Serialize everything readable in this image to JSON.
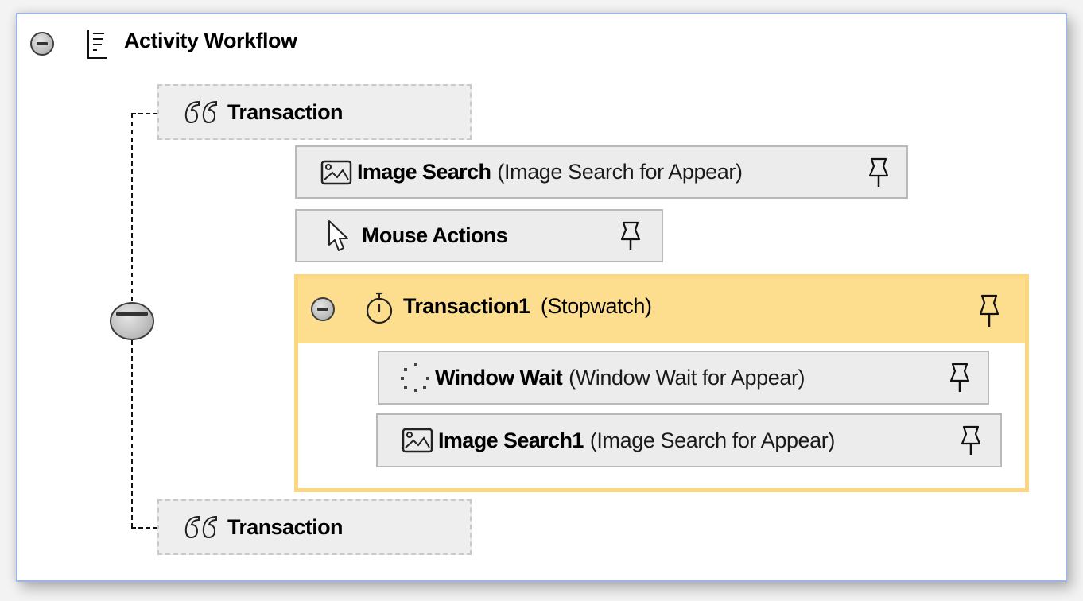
{
  "workflow": {
    "title": "Activity Workflow",
    "title_icon": "list-outline-icon",
    "nodes": [
      {
        "label": "Transaction",
        "icon": "quote-icon",
        "style": "dashed"
      },
      {
        "label": "Image Search",
        "detail": "(Image Search for Appear)",
        "icon": "image-icon",
        "pin": "pin-icon"
      },
      {
        "label": "Mouse Actions",
        "icon": "mouse-pointer-icon",
        "pin": "pin-icon"
      },
      {
        "label": "Transaction1",
        "detail": "(Stopwatch)",
        "icon": "stopwatch-icon",
        "pin": "pin-icon",
        "highlight_color": "#fddd8e",
        "children": [
          {
            "label": "Window Wait",
            "detail": "(Window Wait for Appear)",
            "icon": "loading-dots-icon",
            "pin": "pin-icon"
          },
          {
            "label": "Image Search1",
            "detail": "(Image Search for Appear)",
            "icon": "image-icon",
            "pin": "pin-icon"
          }
        ]
      },
      {
        "label": "Transaction",
        "icon": "quote-icon",
        "style": "dashed"
      }
    ]
  },
  "colors": {
    "panel_border": "#9fb4e4",
    "node_bg": "#ececec",
    "highlight_header": "#fddd8e",
    "highlight_border": "#fcd77f"
  }
}
